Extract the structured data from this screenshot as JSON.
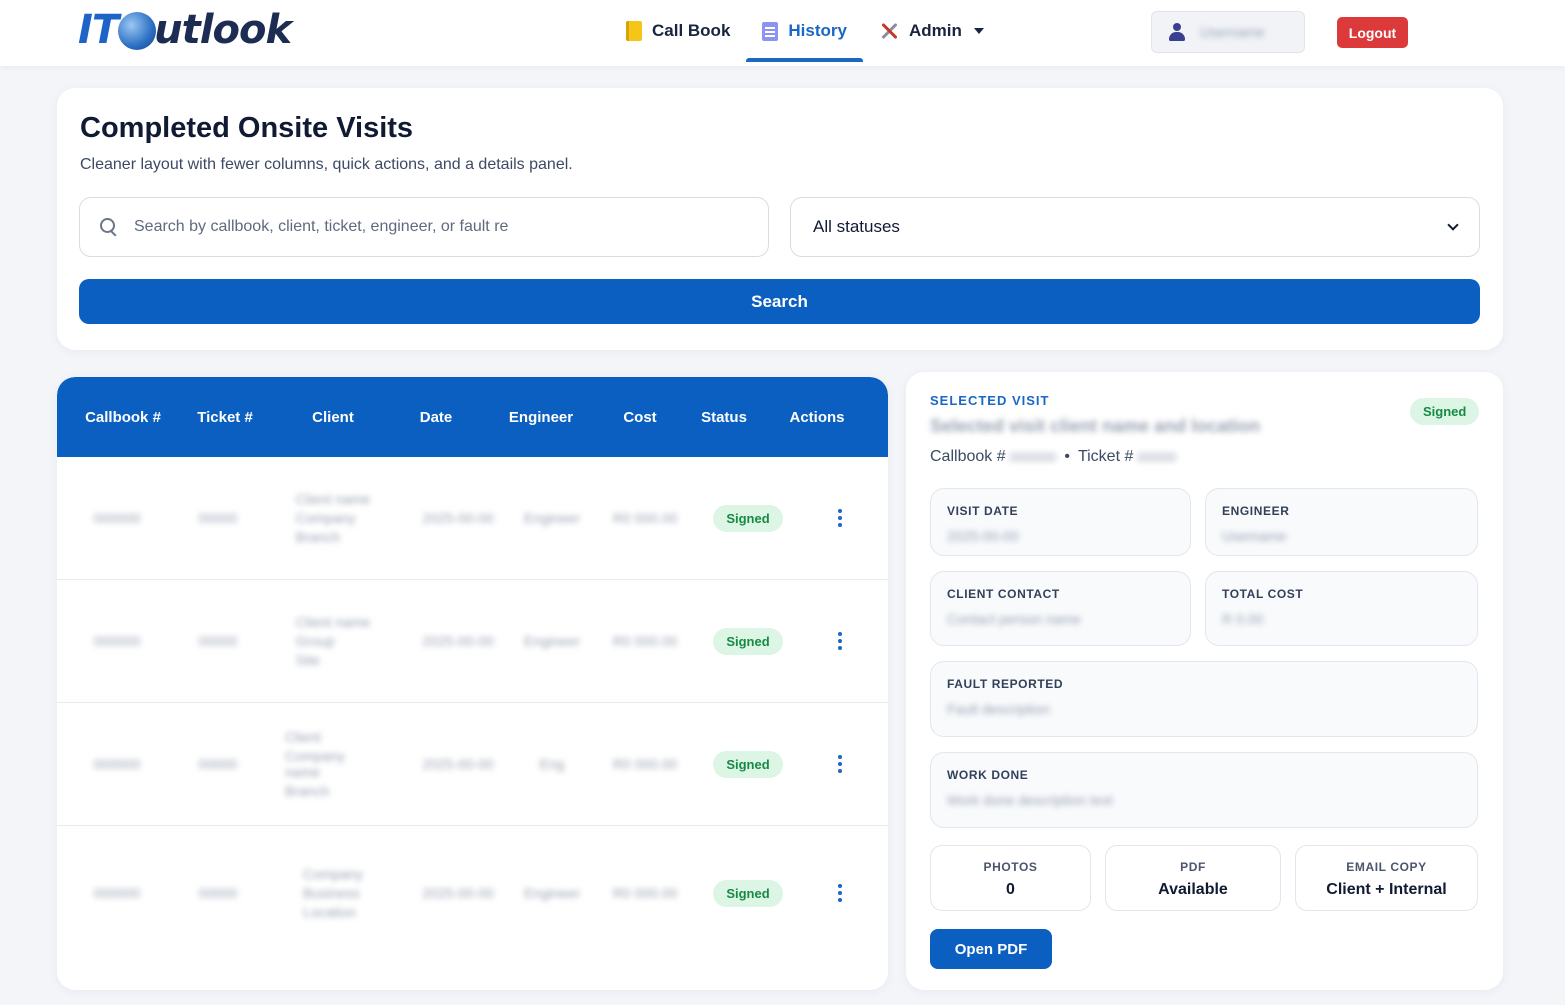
{
  "app": {
    "logo_it": "IT",
    "logo_rest": "utlook",
    "nav": [
      {
        "label": "Call Book"
      },
      {
        "label": "History"
      },
      {
        "label": "Admin"
      }
    ],
    "user_name": "Username",
    "logout_label": "Logout"
  },
  "page": {
    "title": "Completed Onsite Visits",
    "subtitle": "Cleaner layout with fewer columns, quick actions, and a details panel.",
    "search_placeholder": "Search by callbook, client, ticket, engineer, or fault re",
    "status_filter": "All statuses",
    "search_button": "Search"
  },
  "table": {
    "headers": [
      "Callbook #",
      "Ticket #",
      "Client",
      "Date",
      "Engineer",
      "Cost",
      "Status",
      "Actions"
    ],
    "rows": [
      {
        "callbook": "000000",
        "ticket": "00000",
        "client": [
          "Client name",
          "Company",
          "Branch"
        ],
        "date": "2025-00-00",
        "engineer": "Engineer",
        "cost": "R0 000.00",
        "status": "Signed"
      },
      {
        "callbook": "000000",
        "ticket": "00000",
        "client": [
          "Client name",
          "Group",
          "Site"
        ],
        "date": "2025-00-00",
        "engineer": "Engineer",
        "cost": "R0 000.00",
        "status": "Signed"
      },
      {
        "callbook": "000000",
        "ticket": "00000",
        "client": [
          "Client",
          "Company name",
          "Branch"
        ],
        "date": "2025-00-00",
        "engineer": "Eng",
        "cost": "R0 000.00",
        "status": "Signed"
      },
      {
        "callbook": "000000",
        "ticket": "00000",
        "client": [
          "Company",
          "Business",
          "Location"
        ],
        "date": "2025-00-00",
        "engineer": "Engineer",
        "cost": "R0 000.00",
        "status": "Signed"
      }
    ]
  },
  "detail": {
    "section_label": "SELECTED VISIT",
    "visit_name": "Selected visit client name and location",
    "status": "Signed",
    "callbook_prefix": "Callbook #",
    "callbook_value": "000000",
    "separator": "•",
    "ticket_prefix": "Ticket #",
    "ticket_value": "00000",
    "fields": {
      "visit_date": {
        "label": "VISIT DATE",
        "value": "2025-00-00"
      },
      "engineer": {
        "label": "ENGINEER",
        "value": "Username"
      },
      "client_contact": {
        "label": "CLIENT CONTACT",
        "value": "Contact person name"
      },
      "total_cost": {
        "label": "TOTAL COST",
        "value": "R 0.00"
      },
      "fault_reported": {
        "label": "FAULT REPORTED",
        "value": "Fault description"
      },
      "work_done": {
        "label": "WORK DONE",
        "value": "Work done description text"
      }
    },
    "stats": [
      {
        "label": "PHOTOS",
        "value": "0"
      },
      {
        "label": "PDF",
        "value": "Available"
      },
      {
        "label": "EMAIL COPY",
        "value": "Client + Internal"
      }
    ],
    "open_pdf_label": "Open PDF"
  },
  "colors": {
    "primary": "#0b5fc1",
    "danger": "#dc3a3a",
    "success_bg": "#dcf5e4",
    "success_text": "#178a45"
  }
}
